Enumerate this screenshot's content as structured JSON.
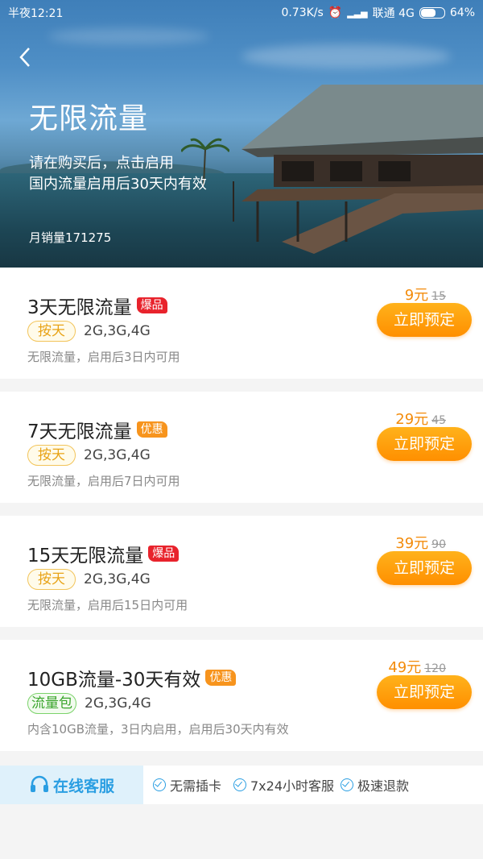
{
  "status": {
    "time": "半夜12:21",
    "speed": "0.73K/s",
    "carrier": "联通 4G",
    "battery": "64%"
  },
  "hero": {
    "title": "无限流量",
    "subtitle_line1": "请在购买后，点击启用",
    "subtitle_line2": "国内流量启用后30天内有效",
    "monthly_sales": "月销量171275"
  },
  "products": [
    {
      "name": "3天无限流量",
      "badge": "爆品",
      "badge_type": "hot",
      "tag": "按天",
      "networks": "2G,3G,4G",
      "desc": "无限流量，启用后3日内可用",
      "price": "9元",
      "old_price": "15",
      "button": "立即预定"
    },
    {
      "name": "7天无限流量",
      "badge": "优惠",
      "badge_type": "promo",
      "tag": "按天",
      "networks": "2G,3G,4G",
      "desc": "无限流量，启用后7日内可用",
      "price": "29元",
      "old_price": "45",
      "button": "立即预定"
    },
    {
      "name": "15天无限流量",
      "badge": "爆品",
      "badge_type": "hot",
      "tag": "按天",
      "networks": "2G,3G,4G",
      "desc": "无限流量，启用后15日内可用",
      "price": "39元",
      "old_price": "90",
      "button": "立即预定"
    },
    {
      "name": "10GB流量-30天有效",
      "badge": "优惠",
      "badge_type": "promo",
      "tag": "流量包",
      "networks": "2G,3G,4G",
      "desc": "内含10GB流量，3日内启用，启用后30天内有效",
      "price": "49元",
      "old_price": "120",
      "button": "立即预定"
    }
  ],
  "service": {
    "label": "在线客服",
    "features": [
      "无需插卡",
      "7x24小时客服",
      "极速退款"
    ]
  },
  "colors": {
    "accent": "#ff9800",
    "service_blue": "#2a9ee2"
  }
}
